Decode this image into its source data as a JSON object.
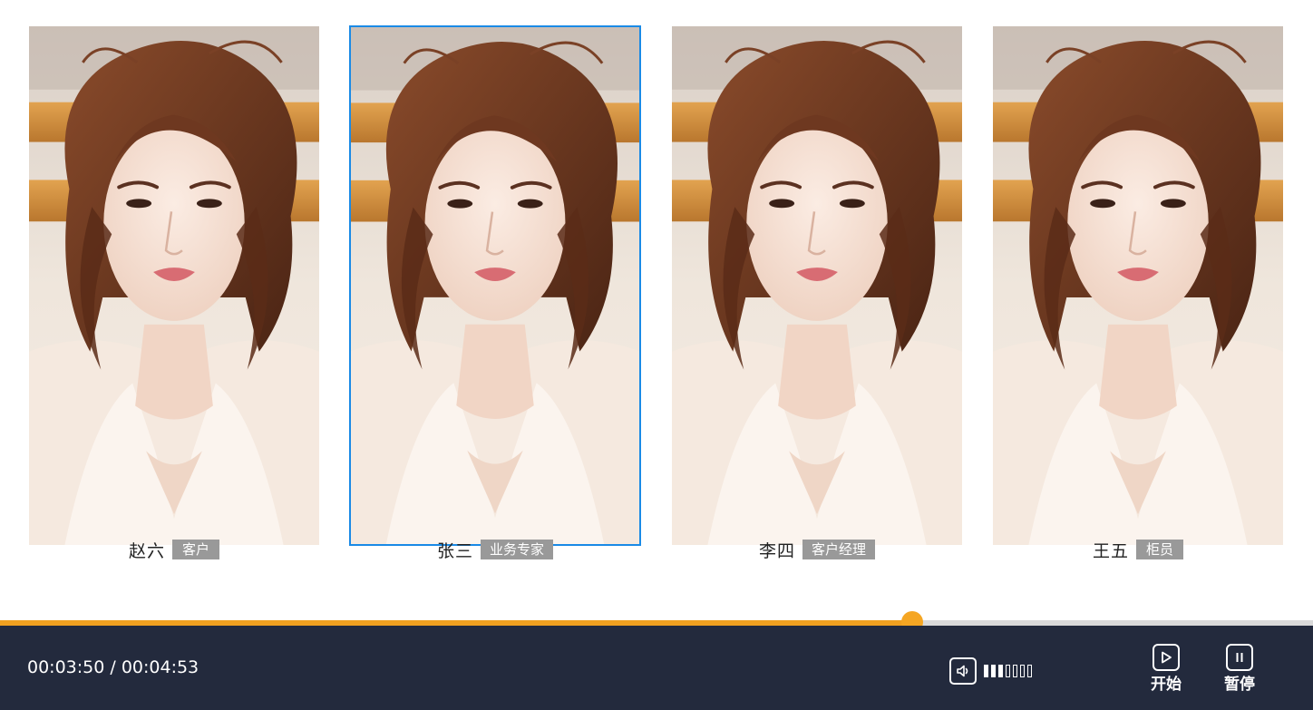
{
  "participants": [
    {
      "name": "赵六",
      "role": "客户",
      "selected": false
    },
    {
      "name": "张三",
      "role": "业务专家",
      "selected": true
    },
    {
      "name": "李四",
      "role": "客户经理",
      "selected": false
    },
    {
      "name": "王五",
      "role": "柜员",
      "selected": false
    }
  ],
  "player": {
    "current_time": "00:03:50",
    "total_time": "00:04:53",
    "time_display": "00:03:50 / 00:04:53",
    "progress_fraction": 0.695,
    "volume_level": 3,
    "volume_max": 7,
    "start_label": "开始",
    "pause_label": "暂停"
  },
  "icons": {
    "volume": "speaker-icon",
    "start": "play-icon",
    "pause": "pause-icon"
  },
  "colors": {
    "selected_border": "#1a8ae6",
    "progress": "#f0a020",
    "control_bar": "#232a3d",
    "role_badge": "#999999"
  }
}
